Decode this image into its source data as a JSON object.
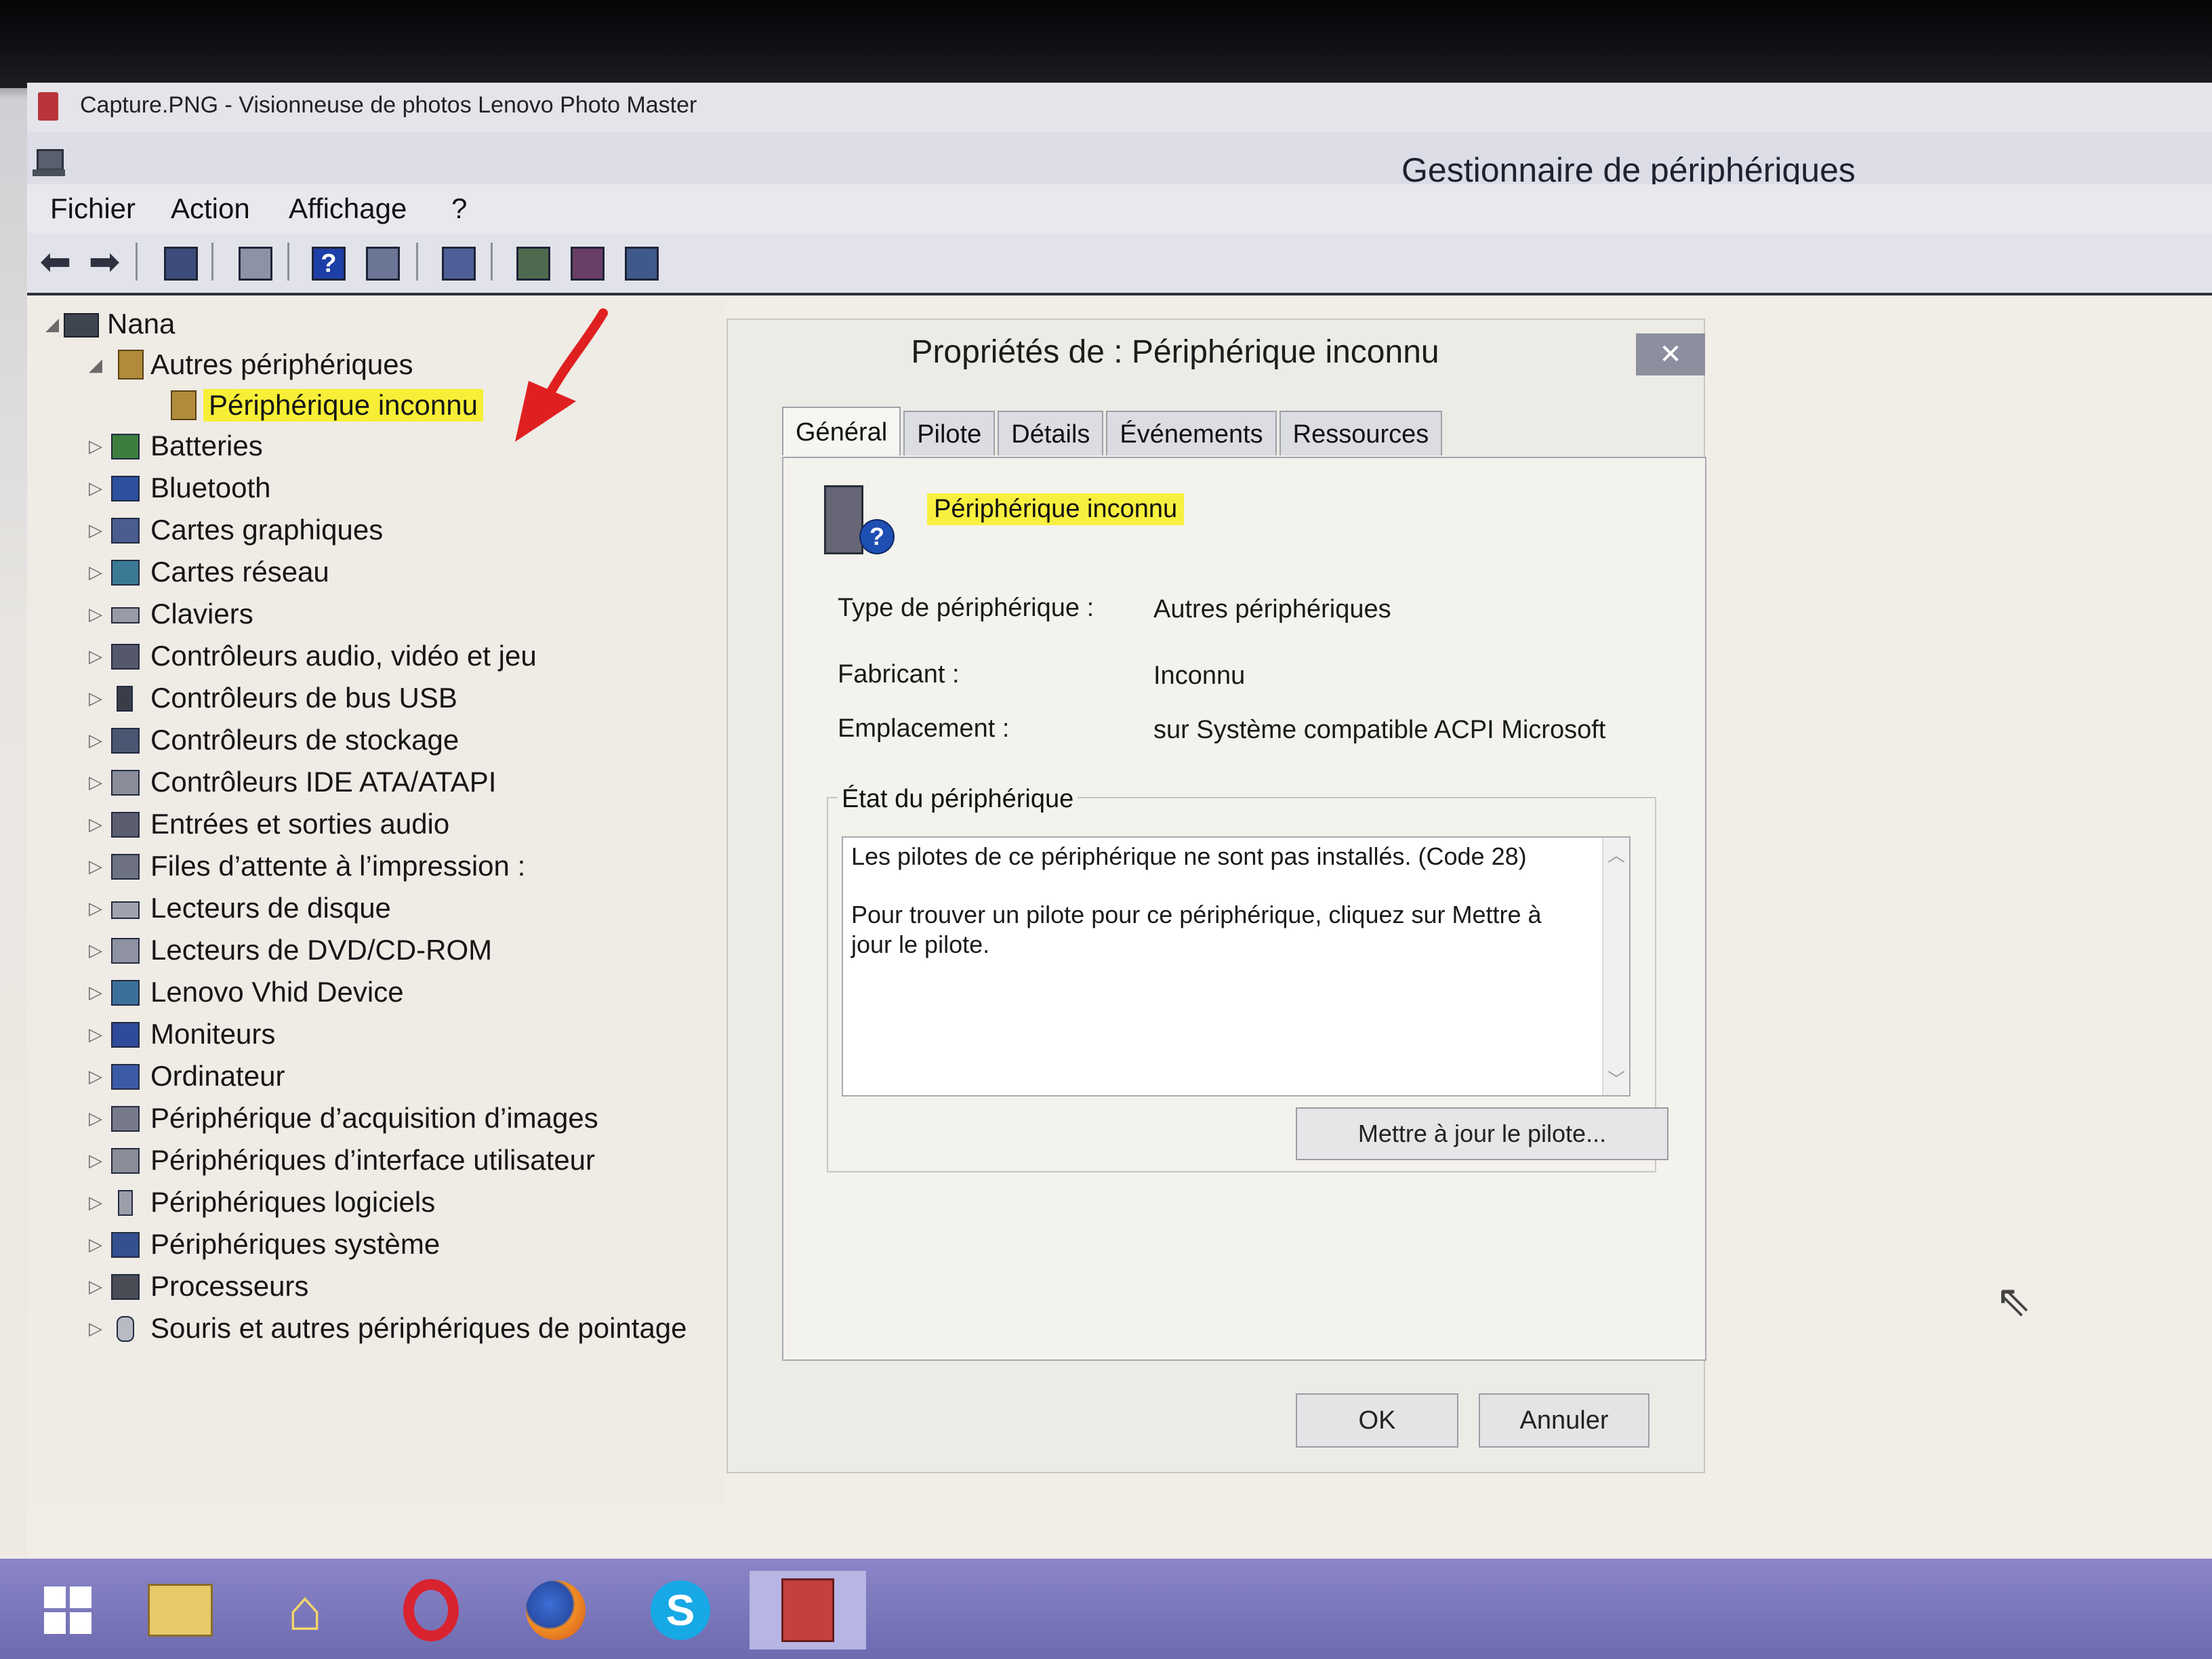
{
  "photo_viewer": {
    "title": "Capture.PNG - Visionneuse de photos Lenovo Photo Master"
  },
  "app": {
    "title": "Gestionnaire de périphériques"
  },
  "menu": [
    "Fichier",
    "Action",
    "Affichage",
    "?"
  ],
  "toolbar": [
    "back-icon",
    "forward-icon",
    "console-tree-icon",
    "properties-icon",
    "help-icon",
    "view-icon",
    "scan-hardware-icon",
    "update-driver-icon",
    "disable-device-icon",
    "uninstall-device-icon"
  ],
  "tree": {
    "root": "Nana",
    "expanded_group": "Autres périphériques",
    "selected_device": "Périphérique inconnu",
    "categories": [
      "Batteries",
      "Bluetooth",
      "Cartes graphiques",
      "Cartes réseau",
      "Claviers",
      "Contrôleurs audio, vidéo et jeu",
      "Contrôleurs de bus USB",
      "Contrôleurs de stockage",
      "Contrôleurs IDE ATA/ATAPI",
      "Entrées et sorties audio",
      "Files d’attente à l’impression :",
      "Lecteurs de disque",
      "Lecteurs de DVD/CD-ROM",
      "Lenovo Vhid Device",
      "Moniteurs",
      "Ordinateur",
      "Périphérique d’acquisition d’images",
      "Périphériques d’interface utilisateur",
      "Périphériques logiciels",
      "Périphériques système",
      "Processeurs",
      "Souris et autres périphériques de pointage"
    ]
  },
  "dialog": {
    "title": "Propriétés de : Périphérique inconnu",
    "close": "✕",
    "tabs": [
      "Général",
      "Pilote",
      "Détails",
      "Événements",
      "Ressources"
    ],
    "device_name": "Périphérique inconnu",
    "type_label": "Type de périphérique :",
    "type_value": "Autres périphériques",
    "manufacturer_label": "Fabricant :",
    "manufacturer_value": "Inconnu",
    "location_label": "Emplacement :",
    "location_value": "sur Système compatible ACPI Microsoft",
    "status_label": "État du périphérique",
    "status_line1": "Les pilotes de ce périphérique ne sont pas installés. (Code 28)",
    "status_line2": "Pour trouver un pilote pour ce périphérique, cliquez sur Mettre à jour le pilote.",
    "update_button": "Mettre à jour le pilote...",
    "ok": "OK",
    "cancel": "Annuler"
  },
  "taskbar": [
    "windows-start-icon",
    "file-explorer-icon",
    "home-icon",
    "opera-icon",
    "firefox-icon",
    "skype-icon",
    "photo-viewer-icon"
  ]
}
